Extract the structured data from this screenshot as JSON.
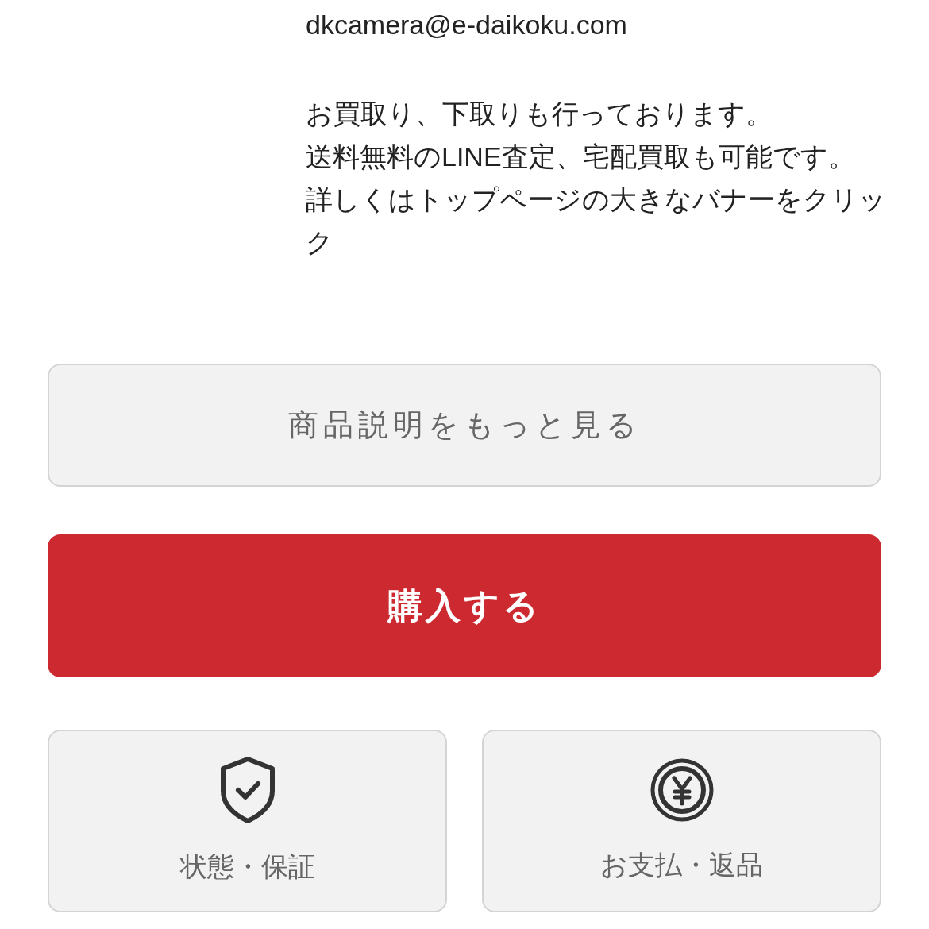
{
  "email": "dkcamera@e-daikoku.com",
  "notes": [
    "お買取り、下取りも行っております。",
    "送料無料のLINE査定、宅配買取も可能です。",
    "詳しくはトップページの大きなバナーをクリック"
  ],
  "more_button": "商品説明をもっと見る",
  "buy_button": "購入する",
  "info_cards": [
    {
      "kind": "shield",
      "label": "状態・保証"
    },
    {
      "kind": "yen",
      "label": "お支払・返品"
    }
  ]
}
